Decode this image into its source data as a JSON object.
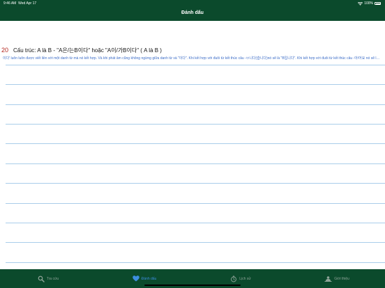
{
  "status_bar": {
    "time": "9:46 AM",
    "date": "Wed Apr 17",
    "battery": "100%",
    "battery_level": 1.0
  },
  "header": {
    "title": "Đánh dấu"
  },
  "entries": [
    {
      "number": "20",
      "title": "Cấu trúc: A là B - \"A은/는B이다\" hoặc \"A이/가B이다\" ( A là B )",
      "description": "이다' luôn luôn được viết liền với một danh từ mà nó kết hợp. Và khi phát âm cũng không ngừng giữa danh từ và \"이다\". Khi kết hợp với đuôi từ kết thúc câu -ㅂ니다(습니다)nó sẽ là \"B입니다\". Khi kết hợp với đuôi từ kết thúc câu -아/어요 nó sẽ là \"B예요/이에요\"."
    }
  ],
  "tabs": [
    {
      "label": "Tra cứu",
      "icon": "search-icon",
      "active": false
    },
    {
      "label": "Đánh dấu",
      "icon": "heart-icon",
      "active": true
    },
    {
      "label": "Lịch sử",
      "icon": "history-icon",
      "active": false
    },
    {
      "label": "Giới thiệu",
      "icon": "info-icon",
      "active": false
    }
  ],
  "colors": {
    "header_bg": "#0b4a2c",
    "tab_active": "#3d8fe0",
    "tab_inactive": "#8fa498",
    "entry_number": "#b3261e",
    "description": "#3b6cc7",
    "rule_line": "#a9cdea"
  }
}
